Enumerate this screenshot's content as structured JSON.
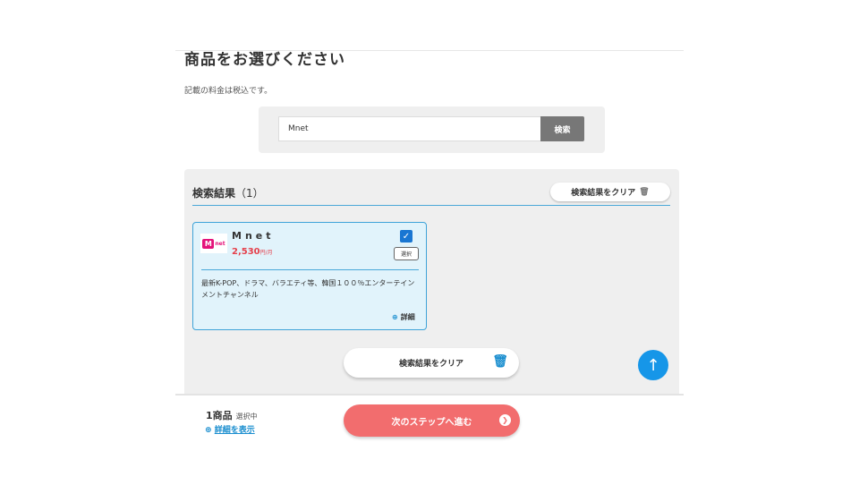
{
  "page": {
    "title": "商品をお選びください",
    "tax_note": "記載の料金は税込です。"
  },
  "search": {
    "value": "Mnet",
    "button_label": "検索"
  },
  "results": {
    "heading": "検索結果",
    "count": "（1）",
    "clear_top_label": "検索結果をクリア",
    "clear_bottom_label": "検索結果をクリア"
  },
  "product": {
    "logo_text": "net",
    "name": "Mnet",
    "price": "2,530",
    "price_unit": "円/月",
    "checked": true,
    "select_label": "選択",
    "description": "最新K-POP、ドラマ、バラエティ等、韓国１００％エンターテインメントチャンネル",
    "detail_label": "詳細"
  },
  "footer": {
    "count": "1商品",
    "count_suffix": "選択中",
    "show_detail": "詳細を表示",
    "next_label": "次のステップへ進む"
  },
  "colors": {
    "accent_blue": "#1a8ecf",
    "card_bg": "#e1f3fb",
    "price_red": "#e5414c",
    "next_button": "#f26d6e",
    "scroll_button": "#1696e8"
  },
  "icons": [
    "trash-icon",
    "check-icon",
    "zoom-icon",
    "arrow-up-icon",
    "chevron-right-icon"
  ]
}
